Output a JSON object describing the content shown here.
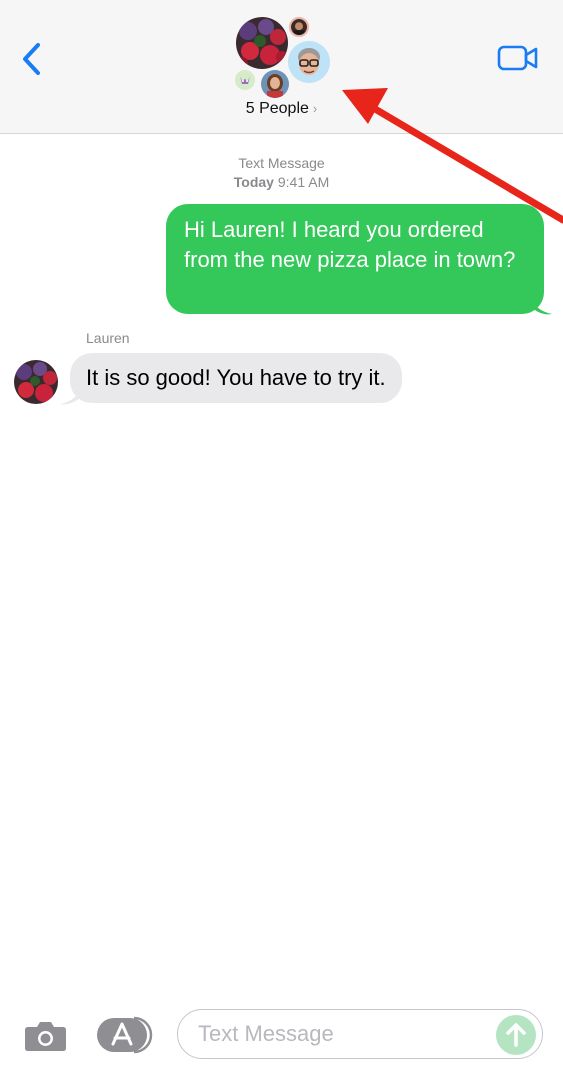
{
  "header": {
    "people_count_label": "5 People",
    "chevron": "›",
    "back_icon": "chevron-left-icon",
    "video_icon": "video-camera-icon",
    "accent_color": "#1a7cf5"
  },
  "conversation": {
    "service_label": "Text Message",
    "timestamp_day": "Today",
    "timestamp_time": "9:41 AM",
    "messages": [
      {
        "direction": "outgoing",
        "text": "Hi Lauren! I heard you ordered from the new pizza place in town?",
        "bubble_color": "#34c759"
      },
      {
        "direction": "incoming",
        "sender": "Lauren",
        "text": "It is so good! You have to try it.",
        "bubble_color": "#e9e9eb"
      }
    ]
  },
  "input_bar": {
    "placeholder": "Text Message",
    "camera_icon": "camera-icon",
    "apps_icon": "app-store-icon",
    "send_icon": "arrow-up-icon"
  },
  "annotation": {
    "color": "#e8251a"
  }
}
